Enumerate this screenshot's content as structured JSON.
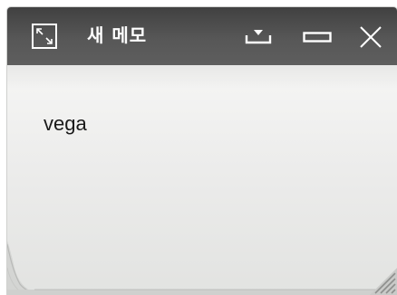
{
  "window": {
    "title": "새 메모"
  },
  "titlebar": {
    "icons": {
      "expand": "expand-icon",
      "pin": "pin-dropdown-icon",
      "minimize": "minimize-icon",
      "close": "close-icon"
    },
    "background_color": "#4c4c4c",
    "icon_color": "#ffffff"
  },
  "note": {
    "content": "vega",
    "background_color": "#ececeb"
  }
}
